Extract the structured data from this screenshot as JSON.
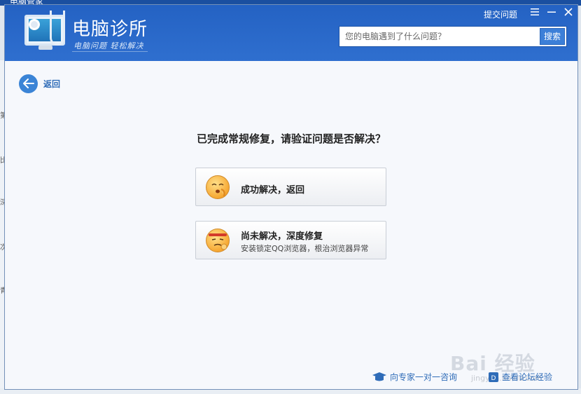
{
  "background_app": {
    "title": "电脑管家",
    "sidebar_fragments": [
      "第",
      "比",
      "深",
      "次",
      "青"
    ]
  },
  "header": {
    "app_title": "电脑诊所",
    "slogan": "电脑问题 轻松解决",
    "feedback_link": "提交问题",
    "search": {
      "placeholder": "您的电脑遇到了什么问题？",
      "button_label": "搜索"
    }
  },
  "back": {
    "label": "返回"
  },
  "question": "已完成常规修复，请验证问题是否解决？",
  "options": [
    {
      "title": "成功解决，返回",
      "subtitle": ""
    },
    {
      "title": "尚未解决，深度修复",
      "subtitle": "安装锁定QQ浏览器，根治浏览器异常"
    }
  ],
  "footer": {
    "expert_link": "向专家一对一咨询",
    "forum_link": "查看论坛经验"
  },
  "watermark": {
    "text": "Bai 经验",
    "sub": "jingyan.baidu.com"
  },
  "colors": {
    "header_blue": "#2462c3",
    "link_blue": "#2f6cb8",
    "back_icon_blue": "#3b84d6"
  },
  "icons": {
    "window_controls": [
      "menu-icon",
      "minimize-icon",
      "close-icon"
    ]
  }
}
